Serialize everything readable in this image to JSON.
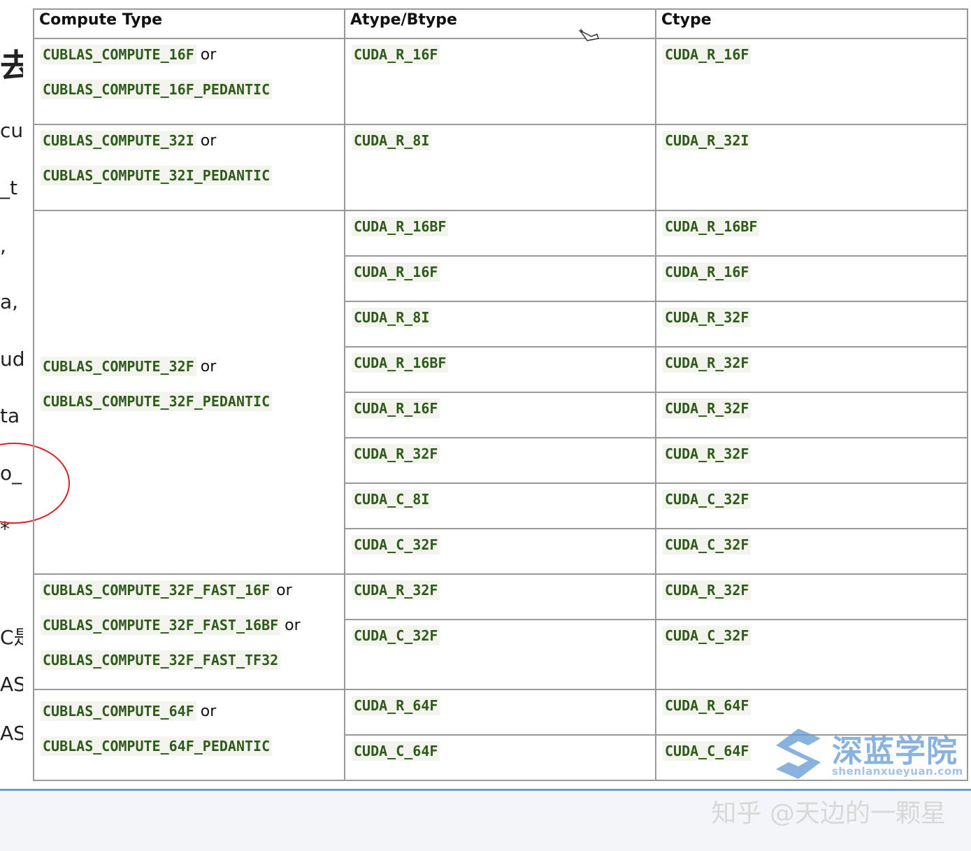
{
  "left_fragments": [
    "去",
    "cuk",
    "_t",
    ",",
    "a,",
    "ud",
    "ta",
    "o_",
    "*",
    "C是",
    "AS",
    "AS"
  ],
  "table": {
    "headers": [
      "Compute Type",
      "Atype/Btype",
      "Ctype"
    ],
    "or_word": "or",
    "groups": [
      {
        "compute": [
          "CUBLAS_COMPUTE_16F",
          "CUBLAS_COMPUTE_16F_PEDANTIC"
        ],
        "rows": [
          {
            "ab": "CUDA_R_16F",
            "c": "CUDA_R_16F"
          }
        ]
      },
      {
        "compute": [
          "CUBLAS_COMPUTE_32I",
          "CUBLAS_COMPUTE_32I_PEDANTIC"
        ],
        "rows": [
          {
            "ab": "CUDA_R_8I",
            "c": "CUDA_R_32I"
          }
        ]
      },
      {
        "compute": [
          "CUBLAS_COMPUTE_32F",
          "CUBLAS_COMPUTE_32F_PEDANTIC"
        ],
        "rows": [
          {
            "ab": "CUDA_R_16BF",
            "c": "CUDA_R_16BF"
          },
          {
            "ab": "CUDA_R_16F",
            "c": "CUDA_R_16F"
          },
          {
            "ab": "CUDA_R_8I",
            "c": "CUDA_R_32F"
          },
          {
            "ab": "CUDA_R_16BF",
            "c": "CUDA_R_32F"
          },
          {
            "ab": "CUDA_R_16F",
            "c": "CUDA_R_32F"
          },
          {
            "ab": "CUDA_R_32F",
            "c": "CUDA_R_32F"
          },
          {
            "ab": "CUDA_C_8I",
            "c": "CUDA_C_32F"
          },
          {
            "ab": "CUDA_C_32F",
            "c": "CUDA_C_32F"
          }
        ]
      },
      {
        "compute": [
          "CUBLAS_COMPUTE_32F_FAST_16F",
          "CUBLAS_COMPUTE_32F_FAST_16BF",
          "CUBLAS_COMPUTE_32F_FAST_TF32"
        ],
        "rows": [
          {
            "ab": "CUDA_R_32F",
            "c": "CUDA_R_32F"
          },
          {
            "ab": "CUDA_C_32F",
            "c": "CUDA_C_32F"
          }
        ]
      },
      {
        "compute": [
          "CUBLAS_COMPUTE_64F",
          "CUBLAS_COMPUTE_64F_PEDANTIC"
        ],
        "rows": [
          {
            "ab": "CUDA_R_64F",
            "c": "CUDA_R_64F"
          },
          {
            "ab": "CUDA_C_64F",
            "c": "CUDA_C_64F"
          }
        ]
      }
    ]
  },
  "logo": {
    "name": "深蓝学院",
    "domain": "shenlanxueyuan.com"
  },
  "watermark": "知乎 @天边的一颗星",
  "cursor_icon": "pointer-cursor-icon",
  "colors": {
    "code_text": "#2e5a1b",
    "code_bg": "#f4f4ee",
    "border": "#999999",
    "circle": "#dd2222",
    "accent_bar": "#6b9bd8"
  }
}
